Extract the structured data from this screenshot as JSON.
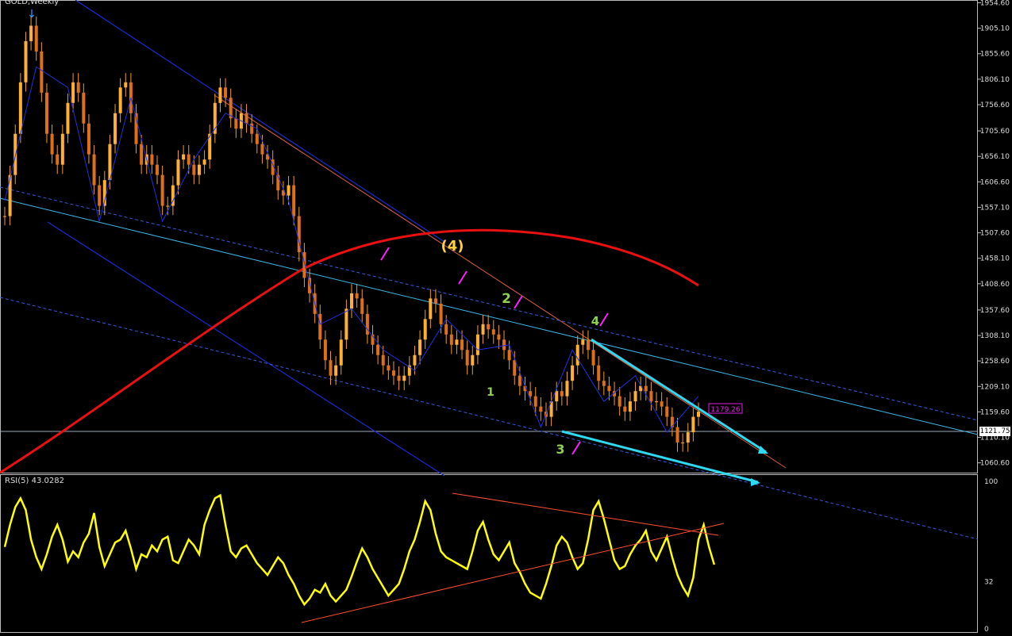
{
  "chart_data": [
    {
      "type": "candlestick",
      "title": "GOLD,Weekly",
      "symbol": "GOLD",
      "timeframe": "Weekly",
      "y_ticks": [
        "1954.60",
        "1905.10",
        "1855.60",
        "1806.10",
        "1756.60",
        "1705.60",
        "1656.10",
        "1606.60",
        "1557.10",
        "1507.60",
        "1458.10",
        "1408.60",
        "1357.60",
        "1308.10",
        "1258.60",
        "1209.10",
        "1159.60",
        "1110.10",
        "1060.60"
      ],
      "ylim": [
        1040,
        1960
      ],
      "current_price": "1121.75",
      "price_label": "1179.26",
      "wave_labels": [
        {
          "text": "(4)",
          "color": "#ffd040"
        },
        {
          "text": "2",
          "color": "#8fd14f"
        },
        {
          "text": "4",
          "color": "#8fd14f"
        },
        {
          "text": "1",
          "color": "#8fd14f"
        },
        {
          "text": "3",
          "color": "#8fd14f"
        }
      ],
      "closes": [
        1540,
        1620,
        1700,
        1800,
        1880,
        1910,
        1860,
        1780,
        1700,
        1660,
        1640,
        1700,
        1760,
        1800,
        1780,
        1720,
        1660,
        1600,
        1560,
        1610,
        1680,
        1740,
        1790,
        1800,
        1740,
        1680,
        1640,
        1660,
        1640,
        1620,
        1560,
        1560,
        1600,
        1650,
        1660,
        1640,
        1620,
        1640,
        1650,
        1700,
        1760,
        1790,
        1770,
        1730,
        1710,
        1740,
        1720,
        1700,
        1680,
        1660,
        1650,
        1620,
        1590,
        1580,
        1600,
        1540,
        1470,
        1420,
        1390,
        1350,
        1300,
        1260,
        1230,
        1250,
        1300,
        1360,
        1390,
        1380,
        1350,
        1310,
        1290,
        1270,
        1250,
        1240,
        1230,
        1220,
        1230,
        1250,
        1270,
        1300,
        1340,
        1380,
        1370,
        1330,
        1310,
        1290,
        1300,
        1280,
        1250,
        1270,
        1310,
        1330,
        1320,
        1310,
        1300,
        1280,
        1260,
        1230,
        1210,
        1200,
        1190,
        1170,
        1160,
        1150,
        1180,
        1200,
        1190,
        1220,
        1250,
        1290,
        1300,
        1280,
        1250,
        1220,
        1210,
        1200,
        1190,
        1170,
        1160,
        1180,
        1200,
        1210,
        1200,
        1180,
        1180,
        1170,
        1150,
        1130,
        1100,
        1100,
        1120,
        1150,
        1160
      ],
      "rsi": {
        "title": "RSI(5) 43.0282",
        "levels": [
          "100",
          "32",
          "0"
        ],
        "values": [
          55,
          70,
          82,
          88,
          80,
          60,
          48,
          40,
          50,
          62,
          70,
          60,
          45,
          52,
          48,
          58,
          64,
          78,
          55,
          42,
          50,
          58,
          60,
          66,
          54,
          40,
          50,
          48,
          56,
          52,
          60,
          62,
          46,
          44,
          52,
          60,
          56,
          50,
          70,
          80,
          88,
          90,
          70,
          52,
          48,
          54,
          56,
          50,
          44,
          40,
          36,
          42,
          48,
          44,
          36,
          30,
          22,
          16,
          20,
          26,
          24,
          30,
          22,
          18,
          22,
          26,
          35,
          45,
          54,
          48,
          40,
          34,
          28,
          22,
          26,
          30,
          40,
          52,
          60,
          72,
          86,
          80,
          64,
          52,
          48,
          46,
          44,
          42,
          40,
          52,
          66,
          72,
          60,
          50,
          46,
          52,
          58,
          44,
          38,
          30,
          24,
          22,
          20,
          30,
          42,
          56,
          62,
          58,
          48,
          40,
          44,
          60,
          80,
          86,
          74,
          60,
          46,
          40,
          42,
          50,
          56,
          60,
          66,
          52,
          46,
          54,
          62,
          48,
          36,
          28,
          22,
          34,
          60,
          70,
          55,
          43
        ]
      }
    }
  ]
}
